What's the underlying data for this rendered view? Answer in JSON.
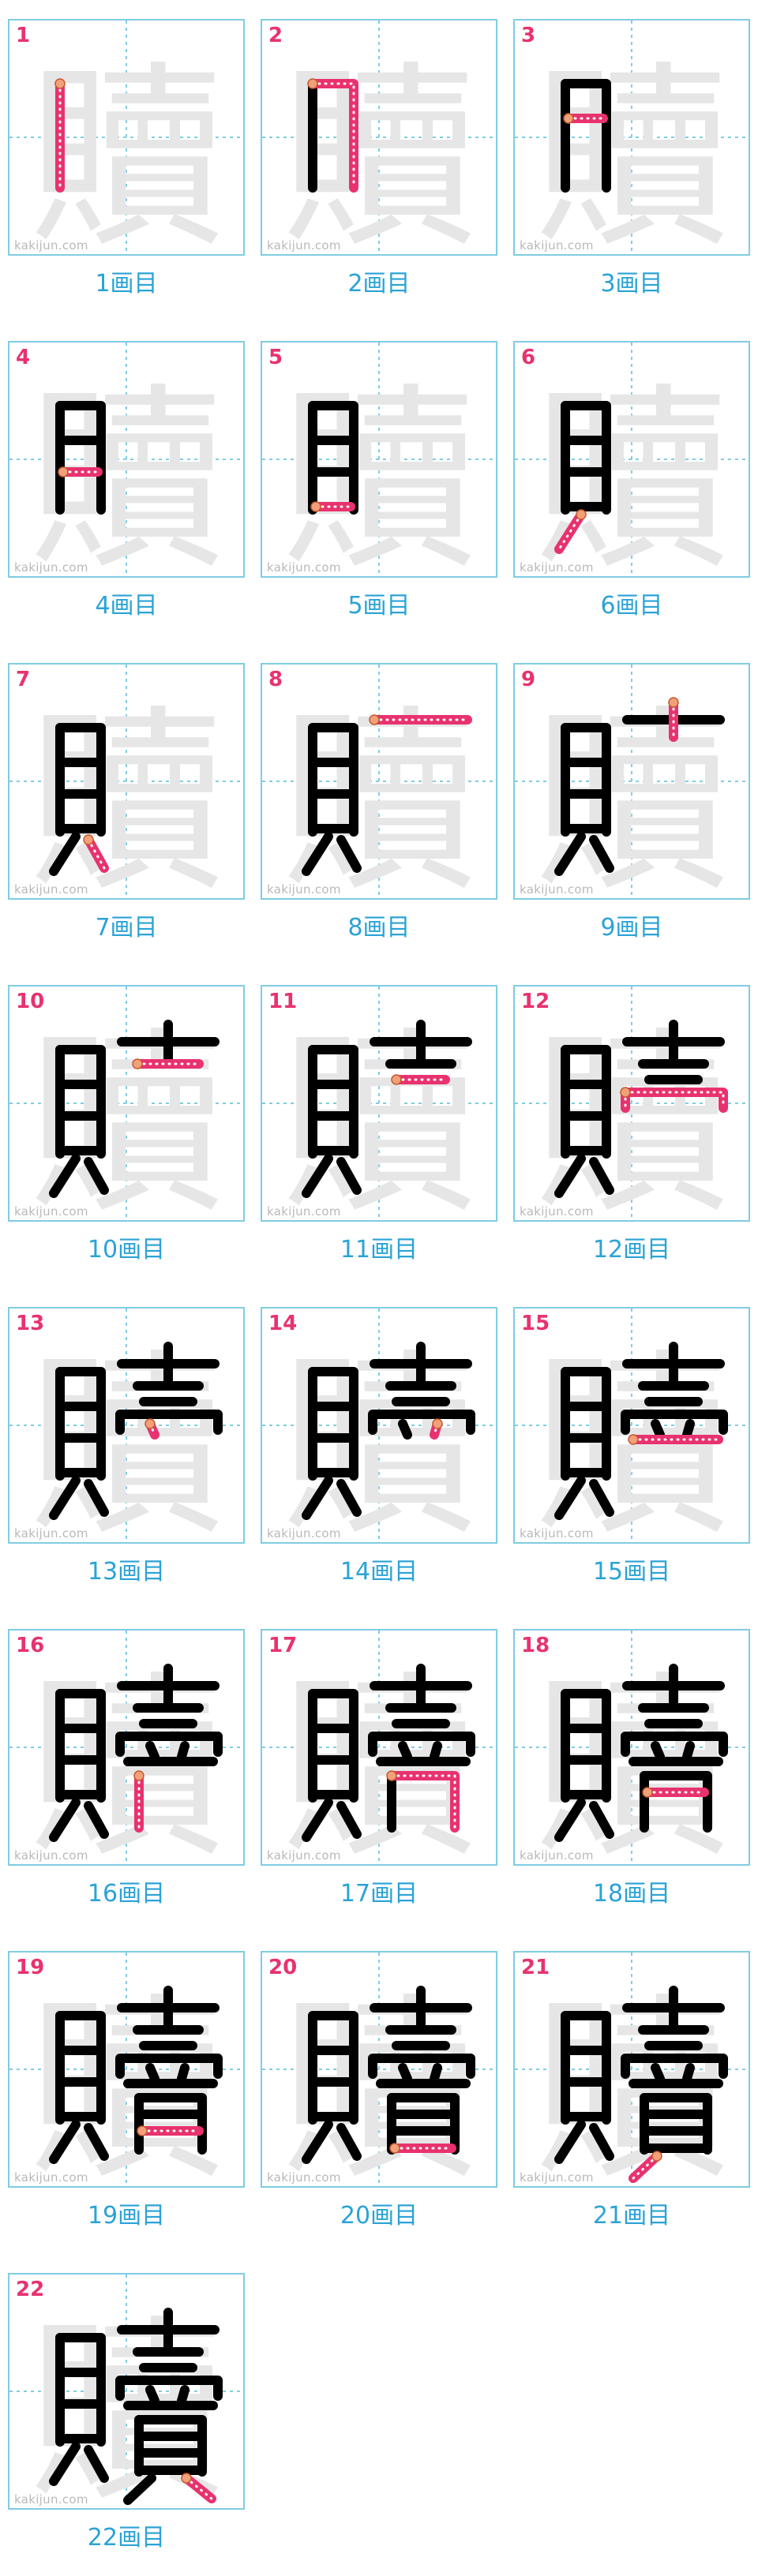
{
  "watermark": "kakijun.com",
  "kanji": "贖",
  "colors": {
    "panel_border": "#7fcde3",
    "guide": "#7fcde3",
    "ghost": "#e6e6e6",
    "ink": "#000000",
    "current_stroke": "#e8326e",
    "start_dot": "#f2a07a",
    "number": "#e8326e",
    "caption": "#2aa3d6"
  },
  "steps": [
    {
      "number": "1",
      "caption": "1画目"
    },
    {
      "number": "2",
      "caption": "2画目"
    },
    {
      "number": "3",
      "caption": "3画目"
    },
    {
      "number": "4",
      "caption": "4画目"
    },
    {
      "number": "5",
      "caption": "5画目"
    },
    {
      "number": "6",
      "caption": "6画目"
    },
    {
      "number": "7",
      "caption": "7画目"
    },
    {
      "number": "8",
      "caption": "8画目"
    },
    {
      "number": "9",
      "caption": "9画目"
    },
    {
      "number": "10",
      "caption": "10画目"
    },
    {
      "number": "11",
      "caption": "11画目"
    },
    {
      "number": "12",
      "caption": "12画目"
    },
    {
      "number": "13",
      "caption": "13画目"
    },
    {
      "number": "14",
      "caption": "14画目"
    },
    {
      "number": "15",
      "caption": "15画目"
    },
    {
      "number": "16",
      "caption": "16画目"
    },
    {
      "number": "17",
      "caption": "17画目"
    },
    {
      "number": "18",
      "caption": "18画目"
    },
    {
      "number": "19",
      "caption": "19画目"
    },
    {
      "number": "20",
      "caption": "20画目"
    },
    {
      "number": "21",
      "caption": "21画目"
    },
    {
      "number": "22",
      "caption": "22画目"
    }
  ]
}
